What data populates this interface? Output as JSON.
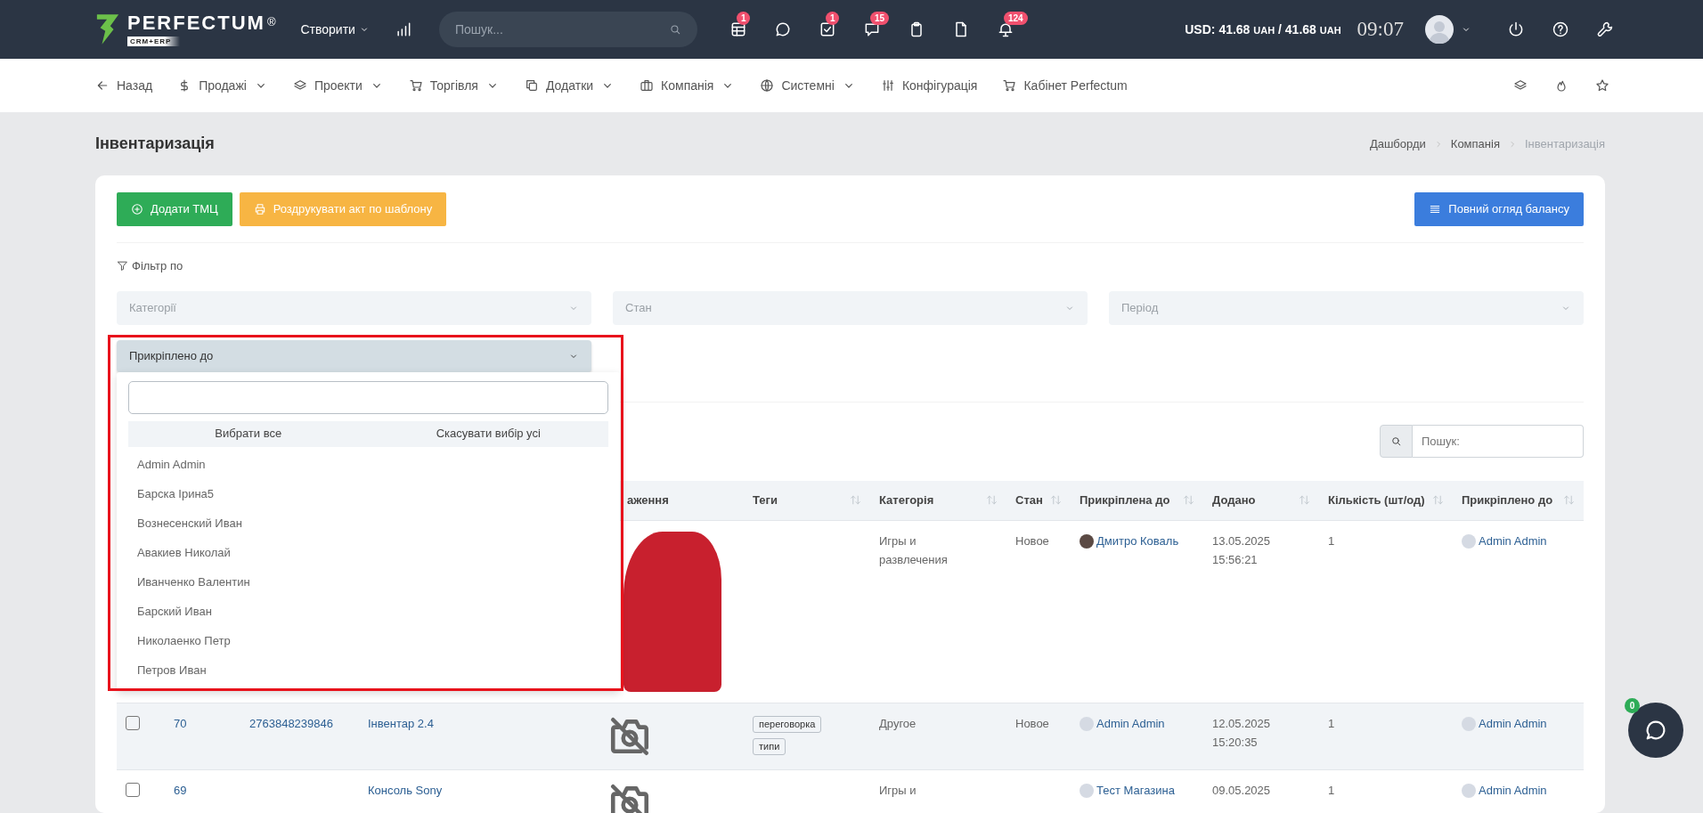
{
  "topbar": {
    "logo": {
      "title": "PERFECTUM",
      "mark": "®",
      "subtitle": "CRM+ERP"
    },
    "create_menu": {
      "label": "Створити"
    },
    "search": {
      "placeholder": "Пошук..."
    },
    "icons": [
      {
        "kind": "table",
        "badge": "1"
      },
      {
        "kind": "chat"
      },
      {
        "kind": "task",
        "badge": "1"
      },
      {
        "kind": "messages",
        "badge": "15"
      },
      {
        "kind": "clipboard"
      },
      {
        "kind": "file"
      },
      {
        "kind": "bell",
        "badge": "124"
      }
    ],
    "currency": {
      "label": "USD:",
      "rates": [
        {
          "amount": "41.68",
          "unit": "UAH"
        },
        {
          "amount": "41.68",
          "unit": "UAH"
        }
      ],
      "separator": "/"
    },
    "time": "09:07"
  },
  "navbar": {
    "items": [
      {
        "kind": "back",
        "label": "Назад",
        "dropdown": false
      },
      {
        "kind": "dollar",
        "label": "Продажі",
        "dropdown": true
      },
      {
        "kind": "layers",
        "label": "Проекти",
        "dropdown": true
      },
      {
        "kind": "cart",
        "label": "Торгівля",
        "dropdown": true
      },
      {
        "kind": "copy",
        "label": "Додатки",
        "dropdown": true
      },
      {
        "kind": "briefcase",
        "label": "Компанія",
        "dropdown": true
      },
      {
        "kind": "globe",
        "label": "Системні",
        "dropdown": true
      },
      {
        "kind": "sliders",
        "label": "Конфігурація",
        "dropdown": false
      },
      {
        "kind": "cart",
        "label": "Кабінет Perfectum",
        "dropdown": false
      }
    ],
    "tools": [
      {
        "kind": "layers"
      },
      {
        "kind": "fire"
      },
      {
        "kind": "star"
      }
    ]
  },
  "page": {
    "title": "Інвентаризація",
    "breadcrumbs": [
      {
        "label": "Дашборди",
        "current": false
      },
      {
        "label": "Компанія",
        "current": false
      },
      {
        "label": "Інвентаризація",
        "current": true
      }
    ]
  },
  "toolbar": {
    "buttons": [
      {
        "kind": "add",
        "label": "Додати ТМЦ"
      },
      {
        "kind": "print",
        "label": "Роздрукувати акт по шаблону"
      }
    ],
    "balance_button": {
      "kind": "list",
      "label": "Повний огляд балансу"
    }
  },
  "filter": {
    "label": "Фільтр по",
    "selects": [
      {
        "placeholder": "Категорії",
        "open": false
      },
      {
        "placeholder": "Стан",
        "open": false
      },
      {
        "placeholder": "Період",
        "open": false
      },
      {
        "placeholder": "Прикріплено до",
        "open": true
      }
    ],
    "dropdown": {
      "select_all": "Вибрати все",
      "deselect_all": "Скасувати вибір усі",
      "options": [
        {
          "label": "Admin Admin",
          "selected": false
        },
        {
          "label": "Барска Ірина5",
          "selected": false
        },
        {
          "label": "Вознесенский Иван",
          "selected": false
        },
        {
          "label": "Авакиев Николай",
          "selected": false
        },
        {
          "label": "Иванченко Валентин",
          "selected": false
        },
        {
          "label": "Барский Иван",
          "selected": false
        },
        {
          "label": "Николаенко Петр",
          "selected": false
        },
        {
          "label": "Петров Иван",
          "selected": false
        }
      ]
    }
  },
  "table_search": {
    "placeholder": "Пошук:"
  },
  "table": {
    "columns": [
      {
        "label": "аження",
        "sortable": false
      },
      {
        "label": "Теги",
        "sortable": true
      },
      {
        "label": "Категорія",
        "sortable": true
      },
      {
        "label": "Стан",
        "sortable": true
      },
      {
        "label": "Прикріплена до",
        "sortable": true
      },
      {
        "label": "Додано",
        "sortable": true
      },
      {
        "label": "Кількість (шт/од)",
        "sortable": true
      },
      {
        "label": "Прикріплено до",
        "sortable": true
      }
    ],
    "rows": [
      {
        "hovered": false,
        "image": {
          "kind": "photo"
        },
        "category": "Игры и развлечения",
        "state": "Новое",
        "assignee": {
          "name": "Дмитро Коваль",
          "kind": "photo"
        },
        "added": [
          "13.05.2025",
          "15:56:21"
        ],
        "quantity": "1",
        "attached": {
          "name": "Admin Admin",
          "kind": "default"
        }
      },
      {
        "checked": false,
        "hovered": true,
        "id": "70",
        "barcode": "2763848239846",
        "name": "Інвентар 2.4",
        "image": {
          "kind": "none"
        },
        "tags": [
          "переговорка",
          "типи"
        ],
        "category": "Другое",
        "state": "Новое",
        "assignee": {
          "name": "Admin Admin",
          "kind": "default"
        },
        "added": [
          "12.05.2025",
          "15:20:35"
        ],
        "quantity": "1",
        "attached": {
          "name": "Admin Admin",
          "kind": "default"
        }
      },
      {
        "checked": false,
        "hovered": false,
        "id": "69",
        "name": "Консоль Sony",
        "image": {
          "kind": "none"
        },
        "category": "Игры и",
        "assignee": {
          "name": "Тест Магазина",
          "kind": "default"
        },
        "added": [
          "09.05.2025"
        ],
        "quantity": "1",
        "attached": {
          "name": "Admin Admin",
          "kind": "default"
        }
      }
    ]
  },
  "chat": {
    "badge": "0"
  }
}
